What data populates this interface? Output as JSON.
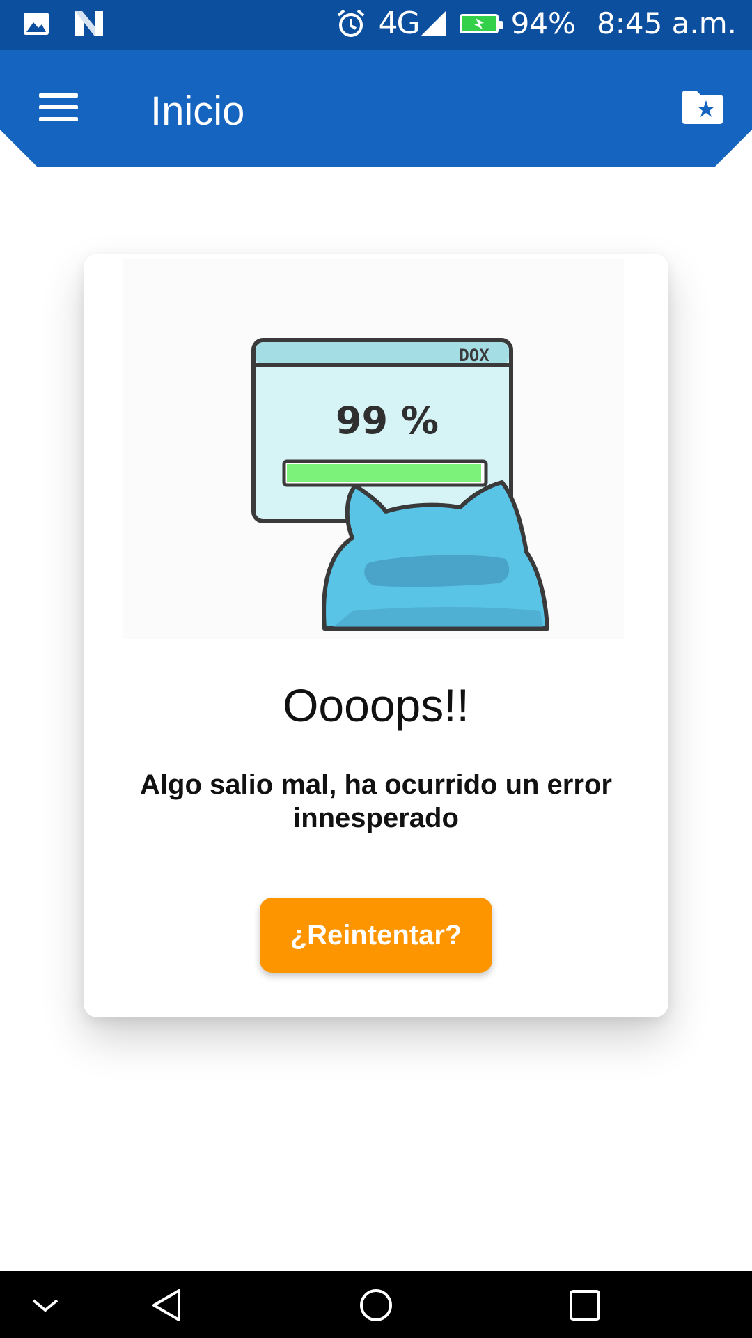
{
  "status_bar": {
    "left_icons": [
      "image-icon",
      "n-notification-icon"
    ],
    "alarm_icon": "alarm-icon",
    "network": "4G",
    "signal_icon": "signal-icon",
    "battery_icon": "battery-charging-icon",
    "battery_percent": "94%",
    "time": "8:45 a.m."
  },
  "app_bar": {
    "title": "Inicio",
    "menu_icon": "hamburger-menu-icon",
    "action_icon": "folder-star-icon",
    "color": "#1565c0"
  },
  "error_card": {
    "illustration": {
      "window_label": "DOX",
      "progress_text": "99 %",
      "progress_fraction": 0.99
    },
    "title": "Oooops!!",
    "message": "Algo salio mal, ha ocurrido un error innesperado",
    "retry_label": "¿Reintentar?",
    "retry_color": "#fd9500"
  },
  "nav_bar": {
    "items": [
      "chevron-down-icon",
      "back-icon",
      "home-icon",
      "recents-icon"
    ]
  }
}
